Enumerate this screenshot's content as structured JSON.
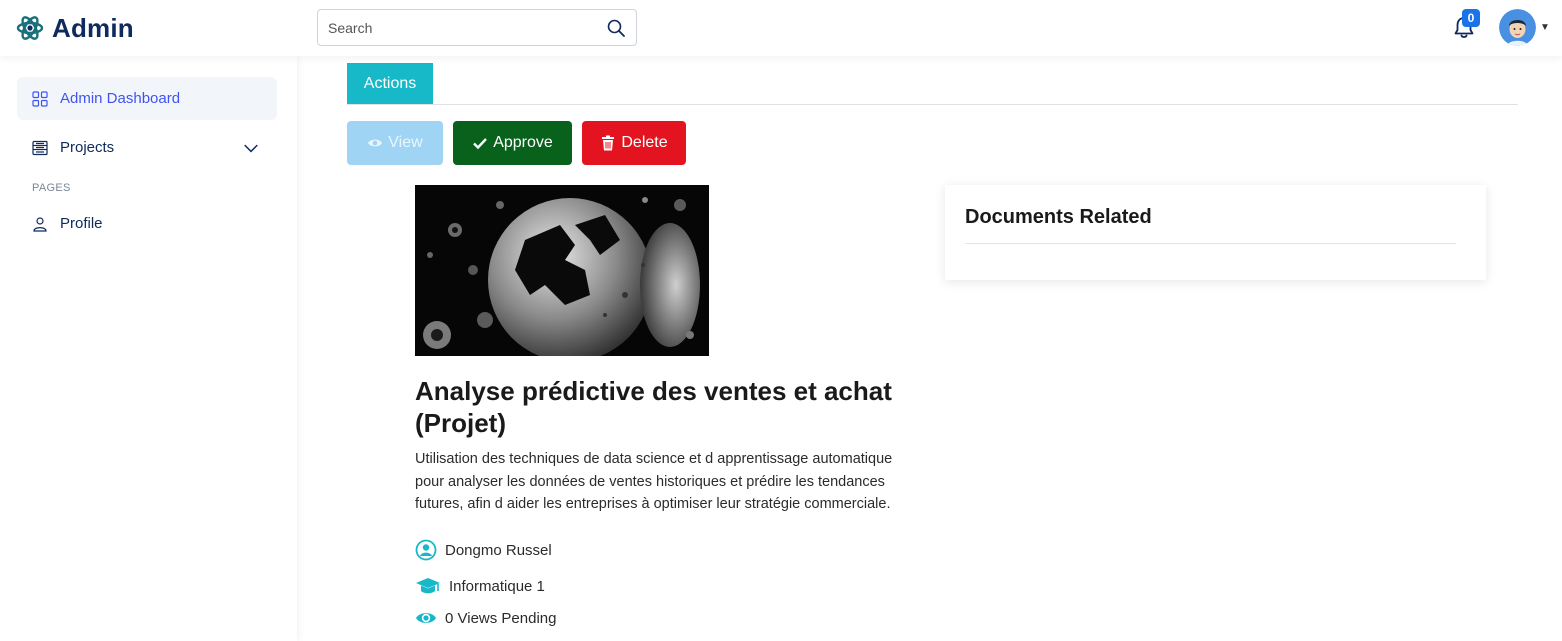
{
  "header": {
    "brand_name": "Admin",
    "search_placeholder": "Search",
    "notifications_count": "0"
  },
  "sidebar": {
    "items": [
      {
        "label": "Admin Dashboard",
        "icon": "grid-icon",
        "active": true
      },
      {
        "label": "Projects",
        "icon": "list-icon",
        "expandable": true
      },
      {
        "label": "Profile",
        "icon": "person-icon"
      }
    ],
    "section_heading": "PAGES"
  },
  "main": {
    "tab_label": "Actions",
    "buttons": {
      "view": "View",
      "approve": "Approve",
      "delete": "Delete"
    },
    "project": {
      "title": "Analyse prédictive des ventes et achat (Projet)",
      "description": "Utilisation des techniques de data science et d apprentissage automatique pour analyser les données de ventes historiques et prédire les tendances futures, afin d aider les entreprises à optimiser leur stratégie commerciale.",
      "author": "Dongmo Russel",
      "department": "Informatique 1",
      "views_status": "0 Views Pending"
    },
    "documents_card": {
      "title": "Documents Related"
    }
  },
  "colors": {
    "brand": "#0f2a5c",
    "accent": "#4154f1",
    "tab": "#17b8c8",
    "view_button": "#9fd4f5",
    "approve_button": "#08621c",
    "delete_button": "#e3141f",
    "meta_icons": "#17b8c8"
  }
}
